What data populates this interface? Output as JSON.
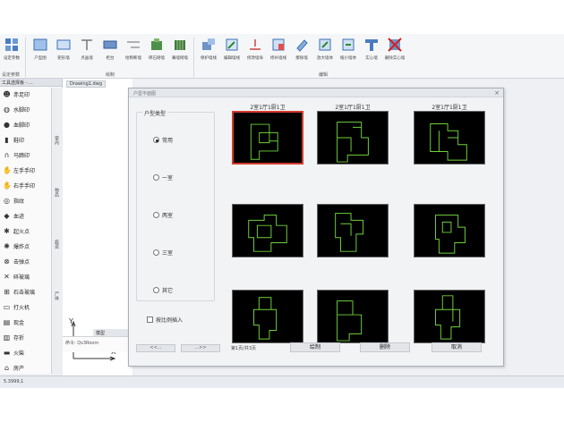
{
  "ribbon": {
    "buttons": [
      {
        "label": "设定参数",
        "icon": "settings-grid-icon"
      },
      {
        "label": "户型图",
        "icon": "floorplan-icon"
      },
      {
        "label": "矩形墙",
        "icon": "rect-wall-icon"
      },
      {
        "label": "点画墙",
        "icon": "point-wall-icon"
      },
      {
        "label": "柜台",
        "icon": "counter-icon"
      },
      {
        "label": "绘制断墙",
        "icon": "broken-wall-icon"
      },
      {
        "label": "砖石砌墙",
        "icon": "brick-wall-icon"
      },
      {
        "label": "幕墙砌墙",
        "icon": "curtain-wall-icon"
      },
      {
        "label": "保护墙线",
        "icon": "protect-wall-icon"
      },
      {
        "label": "编辑墙线",
        "icon": "edit-wall-icon"
      },
      {
        "label": "修改墙垛",
        "icon": "modify-pier-icon"
      },
      {
        "label": "修补墙线",
        "icon": "repair-wall-icon"
      },
      {
        "label": "擦除墙",
        "icon": "erase-wall-icon"
      },
      {
        "label": "放大墙体",
        "icon": "enlarge-wall-icon"
      },
      {
        "label": "缩小墙体",
        "icon": "shrink-wall-icon"
      },
      {
        "label": "实心墙",
        "icon": "solid-wall-icon"
      },
      {
        "label": "删除实心墙",
        "icon": "delete-solid-wall-icon"
      }
    ],
    "groups": [
      "设定参数",
      "绘制",
      "编辑"
    ]
  },
  "palette": {
    "title": "工具选择板 - ...",
    "items": [
      {
        "label": "赤足印",
        "icon": "footprint-icon"
      },
      {
        "label": "水脚印",
        "icon": "water-footprint-icon"
      },
      {
        "label": "血脚印",
        "icon": "blood-footprint-icon"
      },
      {
        "label": "鞋印",
        "icon": "shoe-icon"
      },
      {
        "label": "马蹄印",
        "icon": "horseshoe-icon"
      },
      {
        "label": "左手手印",
        "icon": "left-hand-icon"
      },
      {
        "label": "右手手印",
        "icon": "right-hand-icon"
      },
      {
        "label": "指纹",
        "icon": "fingerprint-icon"
      },
      {
        "label": "血迹",
        "icon": "blood-drop-icon"
      },
      {
        "label": "起火点",
        "icon": "fire-point-icon"
      },
      {
        "label": "爆炸点",
        "icon": "explosion-icon"
      },
      {
        "label": "击弹点",
        "icon": "bullet-hit-icon"
      },
      {
        "label": "碎玻璃",
        "icon": "broken-glass-icon"
      },
      {
        "label": "石击玻璃",
        "icon": "stone-glass-icon"
      },
      {
        "label": "打火机",
        "icon": "lighter-icon"
      },
      {
        "label": "现金",
        "icon": "cash-icon"
      },
      {
        "label": "存折",
        "icon": "passbook-icon"
      },
      {
        "label": "火柴",
        "icon": "matches-icon"
      },
      {
        "label": "房产",
        "icon": "property-icon"
      }
    ]
  },
  "sidetabs": [
    "室内",
    "物品",
    "痕迹",
    "尸体"
  ],
  "canvas": {
    "doc_tab": "Drawing1.dwg",
    "model_tab": "模型",
    "command": "命令: Qs3Room"
  },
  "status": {
    "coords": "5.3999,1"
  },
  "dialog": {
    "title": "户型平面图",
    "type_title": "户型类型",
    "types": [
      {
        "label": "常用",
        "selected": true
      },
      {
        "label": "一室",
        "selected": false
      },
      {
        "label": "两室",
        "selected": false
      },
      {
        "label": "三室",
        "selected": false
      },
      {
        "label": "其它",
        "selected": false
      }
    ],
    "checkbox": "按比例插入",
    "captions": [
      "2室1厅1厨1卫",
      "2室1厅1厨1卫",
      "2室1厅1厨1卫",
      "",
      "",
      "",
      "",
      "",
      ""
    ],
    "prev": "<<...",
    "next": "...>>",
    "page_info": "第1页/共3页",
    "buttons": {
      "ok": "绘制",
      "delete": "删除",
      "cancel": "取消"
    }
  },
  "colors": {
    "selection_border": "#d23a2c",
    "plan_lines": "#6fd23a",
    "thumb_bg": "#000000"
  }
}
